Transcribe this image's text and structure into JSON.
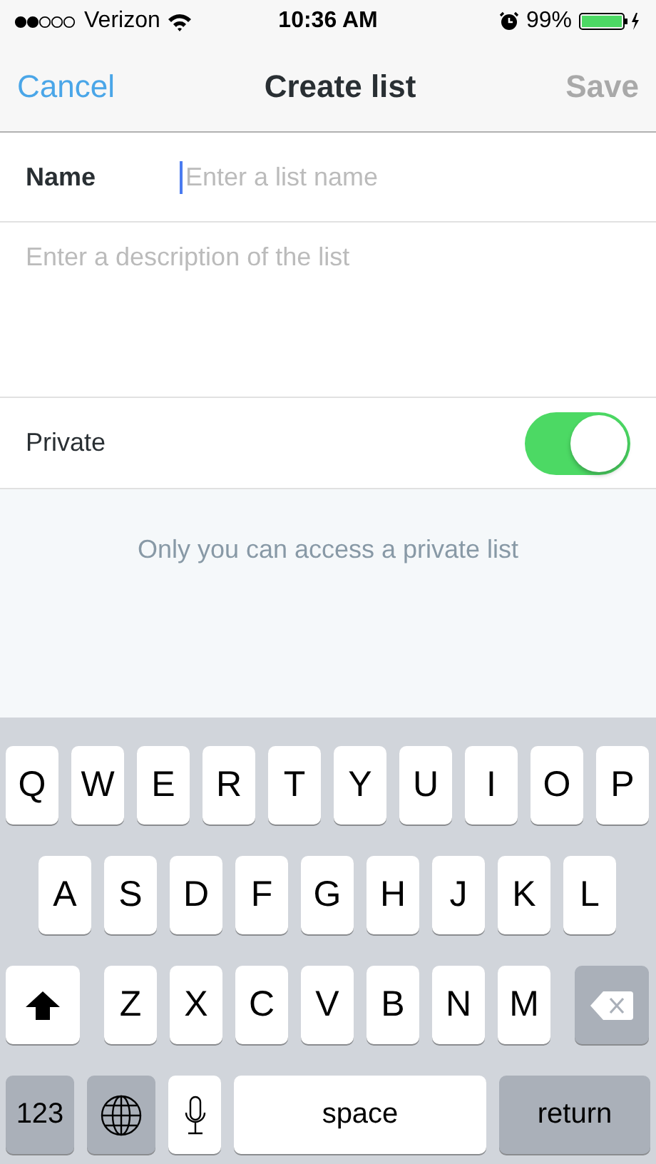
{
  "status_bar": {
    "carrier": "Verizon",
    "time": "10:36 AM",
    "battery": "99%"
  },
  "nav": {
    "cancel": "Cancel",
    "title": "Create list",
    "save": {
      "label": "Save",
      "disabled": true
    }
  },
  "form": {
    "name_label": "Name",
    "name_placeholder": "Enter a list name",
    "description_placeholder": "Enter a description of the list",
    "private_label": "Private",
    "private_on": true,
    "private_note": "Only you can access a private list"
  },
  "keyboard": {
    "rows": [
      [
        {
          "kind": "letter",
          "label": "Q"
        },
        {
          "kind": "letter",
          "label": "W"
        },
        {
          "kind": "letter",
          "label": "E"
        },
        {
          "kind": "letter",
          "label": "R"
        },
        {
          "kind": "letter",
          "label": "T"
        },
        {
          "kind": "letter",
          "label": "Y"
        },
        {
          "kind": "letter",
          "label": "U"
        },
        {
          "kind": "letter",
          "label": "I"
        },
        {
          "kind": "letter",
          "label": "O"
        },
        {
          "kind": "letter",
          "label": "P"
        }
      ],
      [
        {
          "kind": "letter",
          "label": "A"
        },
        {
          "kind": "letter",
          "label": "S"
        },
        {
          "kind": "letter",
          "label": "D"
        },
        {
          "kind": "letter",
          "label": "F"
        },
        {
          "kind": "letter",
          "label": "G"
        },
        {
          "kind": "letter",
          "label": "H"
        },
        {
          "kind": "letter",
          "label": "J"
        },
        {
          "kind": "letter",
          "label": "K"
        },
        {
          "kind": "letter",
          "label": "L"
        }
      ],
      [
        {
          "kind": "shift"
        },
        {
          "kind": "letter",
          "label": "Z"
        },
        {
          "kind": "letter",
          "label": "X"
        },
        {
          "kind": "letter",
          "label": "C"
        },
        {
          "kind": "letter",
          "label": "V"
        },
        {
          "kind": "letter",
          "label": "B"
        },
        {
          "kind": "letter",
          "label": "N"
        },
        {
          "kind": "letter",
          "label": "M"
        },
        {
          "kind": "delete"
        }
      ]
    ],
    "bottom_bar": [
      {
        "kind": "numbers",
        "label": "123"
      },
      {
        "kind": "globe"
      },
      {
        "kind": "mic"
      },
      {
        "kind": "space",
        "label": "space"
      },
      {
        "kind": "return",
        "label": "return"
      }
    ]
  }
}
